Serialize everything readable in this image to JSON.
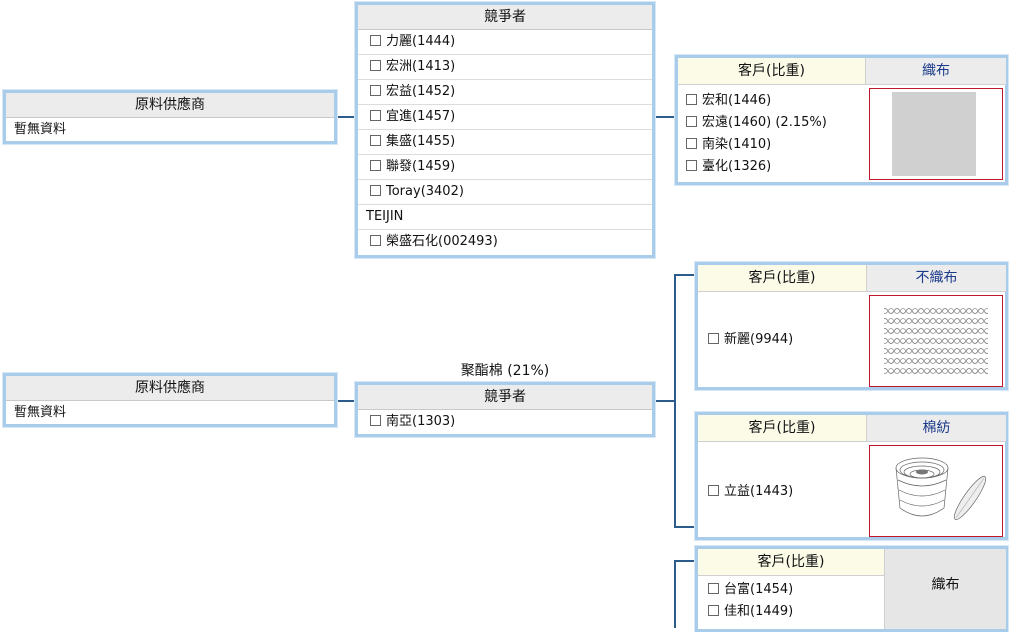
{
  "group1": {
    "supplier": {
      "header": "原料供應商",
      "text": "暫無資料"
    },
    "competitors": {
      "header": "競爭者",
      "items": [
        "力麗(1444)",
        "宏洲(1413)",
        "宏益(1452)",
        "宜進(1457)",
        "集盛(1455)",
        "聯發(1459)",
        "Toray(3402)",
        "TEIJIN",
        "榮盛石化(002493)"
      ]
    },
    "customers": {
      "header": "客戶(比重)",
      "category": "織布",
      "items": [
        "宏和(1446)",
        "宏遠(1460) (2.15%)",
        "南染(1410)",
        "臺化(1326)"
      ]
    }
  },
  "group2": {
    "product_label": "聚酯棉 (21%)",
    "supplier": {
      "header": "原料供應商",
      "text": "暫無資料"
    },
    "competitors": {
      "header": "競爭者",
      "items": [
        "南亞(1303)"
      ]
    },
    "customer_boxes": [
      {
        "header": "客戶(比重)",
        "category": "不織布",
        "items": [
          "新麗(9944)"
        ]
      },
      {
        "header": "客戶(比重)",
        "category": "棉紡",
        "items": [
          "立益(1443)"
        ]
      },
      {
        "header": "客戶(比重)",
        "category": "織布",
        "items": [
          "台富(1454)",
          "佳和(1449)"
        ]
      }
    ]
  },
  "icons": {
    "woven": "woven-fabric-image",
    "nonwoven": "nonwoven-fabric-image",
    "spinning": "cotton-spindle-image"
  }
}
